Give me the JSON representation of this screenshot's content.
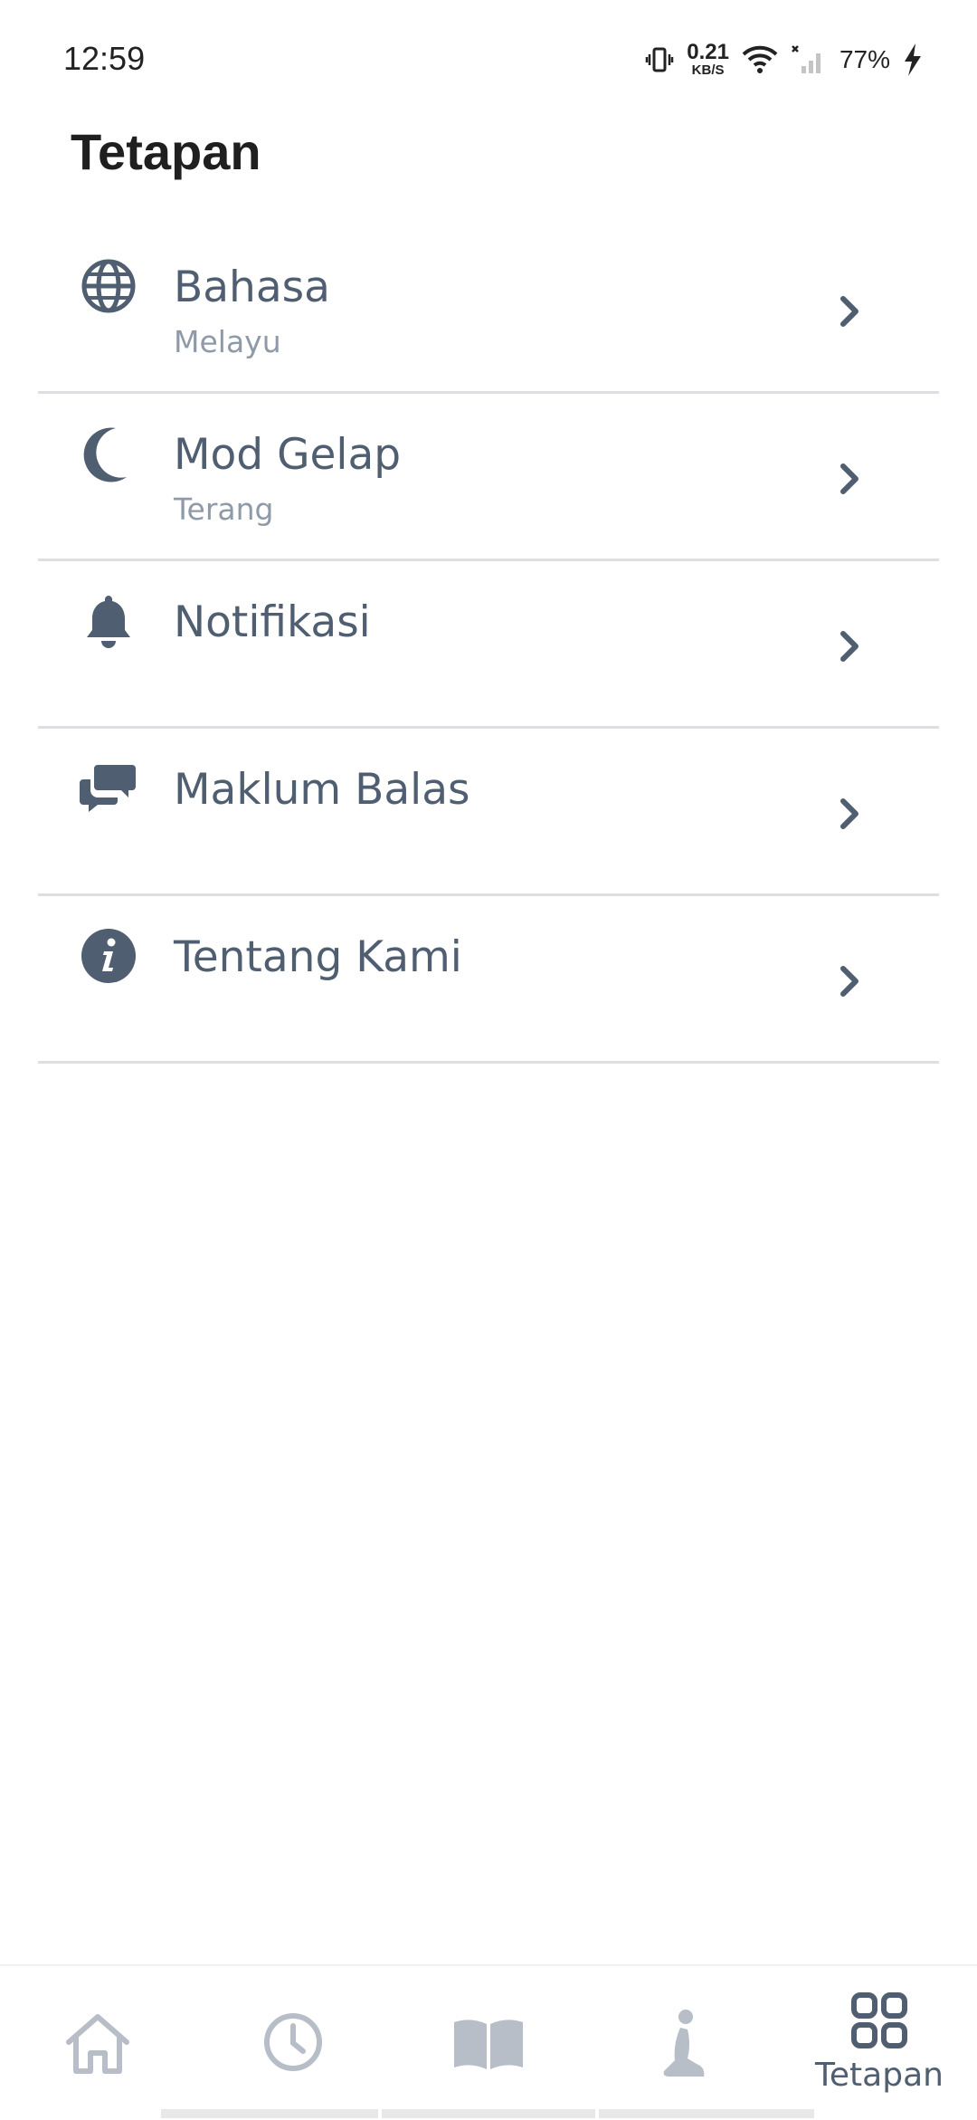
{
  "status_bar": {
    "time": "12:59",
    "net_speed_value": "0.21",
    "net_speed_unit": "KB/S",
    "battery": "77%"
  },
  "page": {
    "title": "Tetapan"
  },
  "settings": [
    {
      "label": "Bahasa",
      "sub": "Melayu",
      "icon": "globe-icon"
    },
    {
      "label": "Mod Gelap",
      "sub": "Terang",
      "icon": "moon-icon"
    },
    {
      "label": "Notifikasi",
      "sub": "",
      "icon": "bell-icon"
    },
    {
      "label": "Maklum Balas",
      "sub": "",
      "icon": "chat-icon"
    },
    {
      "label": "Tentang Kami",
      "sub": "",
      "icon": "info-icon"
    }
  ],
  "bottom_nav": {
    "items": [
      {
        "icon": "home-icon",
        "label": ""
      },
      {
        "icon": "clock-icon",
        "label": ""
      },
      {
        "icon": "book-icon",
        "label": ""
      },
      {
        "icon": "prayer-icon",
        "label": ""
      },
      {
        "icon": "grid-icon",
        "label": "Tetapan",
        "active": true
      }
    ]
  },
  "colors": {
    "text": "#4f5e71",
    "subtext": "#8f9aa8",
    "inactive_nav": "#b7bec7",
    "divider": "#dcdee1"
  }
}
